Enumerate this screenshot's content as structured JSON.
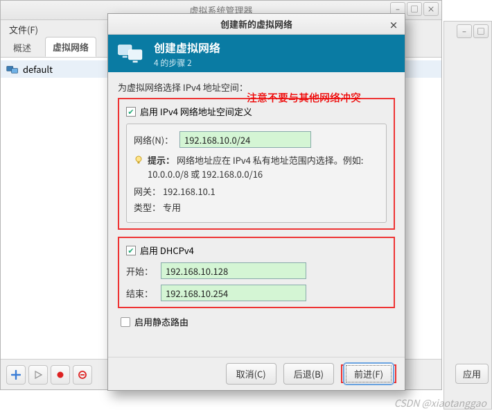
{
  "bg_win": {
    "apply_btn": "应用"
  },
  "parent": {
    "title": "虚拟系统管理器",
    "menu_file": "文件(F)",
    "tabs": {
      "overview": "概述",
      "vnet": "虚拟网络"
    },
    "net_item": "default"
  },
  "dialog": {
    "title": "创建新的虚拟网络",
    "banner_title": "创建虚拟网络",
    "banner_step": "4 的步骤 2",
    "prompt": "为虚拟网络选择 IPv4 地址空间：",
    "ipv4": {
      "enable_label": "启用 IPv4 网络地址空间定义",
      "network_label": "网络(N)：",
      "network_value": "192.168.10.0/24",
      "hint_label": "提示：",
      "hint_text": "网络地址应在 IPv4 私有地址范围内选择。例如: 10.0.0.0/8 或 192.168.0.0/16",
      "gateway_label": "网关：",
      "gateway_value": "192.168.10.1",
      "type_label": "类型：",
      "type_value": "专用"
    },
    "dhcp": {
      "enable_label": "启用 DHCPv4",
      "start_label": "开始：",
      "start_value": "192.168.10.128",
      "end_label": "结束：",
      "end_value": "192.168.10.254"
    },
    "static_route_label": "启用静态路由",
    "buttons": {
      "cancel": "取消(C)",
      "back": "后退(B)",
      "forward": "前进(F)"
    }
  },
  "annotation": "注意不要与其他网络冲突",
  "watermark": "CSDN @xiaotanggao"
}
